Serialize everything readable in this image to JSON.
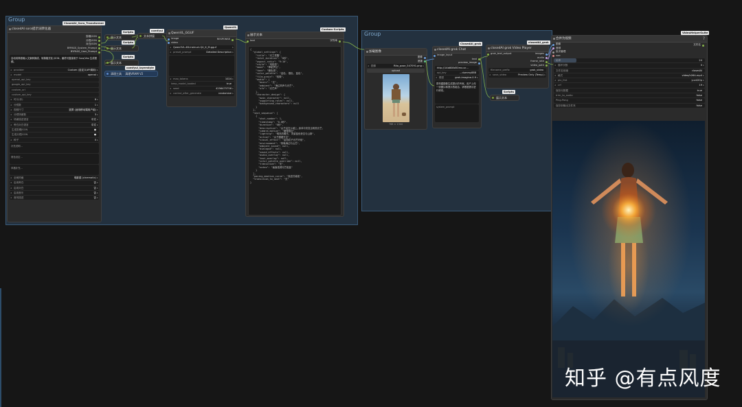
{
  "groups": {
    "left_title": "Group",
    "right_title": "Group"
  },
  "sora_node": {
    "tag": "ClosedAI_Sora_Transformer",
    "id": "#1149 ID",
    "title": "closedAI sora提示词转化器",
    "outputs": [
      "剪辑JSON",
      "分镜JSON",
      "对白JSON",
      "BYPASS_System_Prompt",
      "BYPASS_User_Prompt"
    ],
    "desc": "自动将简易输入文案转换成，转换格式化 JSON，最终可直接用于 Sora/Veo 生成视频。",
    "widgets": [
      {
        "k": "provider",
        "v": "Custom (自定义API调用)"
      },
      {
        "k": "model",
        "v": "openai"
      },
      {
        "k": "openai_api_key",
        "v": ""
      },
      {
        "k": "google_api_key",
        "v": ""
      },
      {
        "k": "custom_url",
        "v": ""
      },
      {
        "k": "custom_api_key",
        "v": ""
      },
      {
        "k": "时长(秒)",
        "v": "8"
      },
      {
        "k": "分镜数",
        "v": "1"
      },
      {
        "k": "视频尺寸",
        "v": "竖屏 (适用移动端用户组)"
      },
      {
        "k": "分镜场景数",
        "v": "3"
      },
      {
        "k": "场景描述语言",
        "v": "中文"
      },
      {
        "k": "旁白对白语言",
        "v": "中文"
      },
      {
        "k": "生成剪辑JSON",
        "v": ""
      },
      {
        "k": "生成分镜JSON",
        "v": ""
      },
      {
        "k": "种子",
        "v": "0"
      }
    ],
    "text_labels": [
      "补充说明...",
      "角色设定...",
      "风格补充..."
    ],
    "bottom_widgets": [
      {
        "k": "全局风格",
        "v": "电影感 (cinematic)"
      },
      {
        "k": "启用旁白",
        "v": "否"
      },
      {
        "k": "启用对白",
        "v": "否"
      },
      {
        "k": "启用音乐",
        "v": "否"
      },
      {
        "k": "音效描述",
        "v": "否"
      }
    ]
  },
  "scripts_nodes": {
    "tag1": "Scripts",
    "id1": "#1141 ID",
    "text1": "展示文本",
    "tag2": "Scripts",
    "id2": "#1146 ID",
    "text2": "展示文本",
    "tag3": "Scripts",
    "id3": "#1143 ID",
    "text3": "展示文本",
    "tag_text_concat": "comfyui",
    "text_concat": "文本拼接",
    "vram_tag": "comfyui_layerstyle",
    "vram_id": "#1144 ID",
    "vram_left": "清理工具",
    "vram_right": "清理VRAM V2"
  },
  "qwen_node": {
    "tag": "QwenVL",
    "id": "#1138 ID",
    "title": "QwenVL_GGUF",
    "inputs": [
      "image",
      "video"
    ],
    "output": "RESPONSE",
    "model": "Qwen3VL-4B-Instruct-Q4_K_M.gguf",
    "preset_prompt_k": "preset_prompt",
    "preset_prompt_v": "Detailed Description",
    "max_tokens_k": "max_tokens",
    "max_tokens_v": "1024",
    "keep_model_k": "keep_model_loaded",
    "keep_model_v": "true",
    "seed_k": "seed",
    "seed_v": "4256475756",
    "control_k": "control_after_generate",
    "control_v": "randomize"
  },
  "show_text_node": {
    "tag": "Custom-Scripts",
    "id": "#1139 ID",
    "title": "展示文本",
    "input": "text",
    "output": "字符串",
    "content": "{\n  \"global_settings\": {\n    \"title\": \"光之觉醒\",\n    \"total_duration\": \"8秒\",\n    \"aspect_ratio\": \"9:16\",\n    \"style\": \"电影感\",\n    \"mood\": \"神秘梦幻\",\n    \"tone\": \"暖色调\",\n    \"color_palette\": \"金色, 橙色, 蓝色\",\n    \"film_grain\": \"轻微\",\n    \"audio\": {\n      \"music\": \"无\",\n      \"ambient\": \"海边风声与光芒\",\n      \"sfx\": \"光芒声\"\n    },\n    \"character_design\": {\n      \"main_character\": null,\n      \"supporting_roles\": null,\n      \"background_characters\": null\n    }\n  },\n  \"shot_sequence\": [\n    {\n      \"shot_number\": 1,\n      \"timestamp\": \"0-8秒\",\n      \"duration\": \"8秒\",\n      \"description\": \"女子站在沙滩上,身体中央发出明亮光芒,\n      \"camera_motion\": \"缓慢推近\",\n      \"lighting\": \"明亮的暖光, 背景蓝色夜空与山脉\",\n      \"action\": \"女子缓缓升空\",\n      \"visual_effect\": \"金色粒子光芒环绕\",\n      \"environment\": \"夜晚海边与山峦\",\n      \"ambient_sound\": null,\n      \"dialogue\": null,\n      \"sound_effects\": null,\n      \"audio_overlay\": null,\n      \"text_overlay\": null,\n      \"color_palette_override\": null,\n      \"transition\": \"无\",\n      \"notes\": \"画面强调光芒能量\"\n    }\n  ],\n  \"pacing_emotion_curve\": \"渐进式增强\",\n  \"transition_to_next\": \"无\"\n}"
  },
  "load_image_node": {
    "id": "#1 ID",
    "title": "加载图像",
    "outputs": [
      "图像",
      "遮罩"
    ],
    "image_k": "图像",
    "image_v": "Rita_pose_547091.png",
    "upload": "upload",
    "size_label": "768 × 1344"
  },
  "grok_chat_node": {
    "tag": "ClosedAI_grok",
    "id": "#1,186 ID",
    "title": "closedAI grok Chat",
    "inputs": [
      "image_input"
    ],
    "outputs": [
      "text",
      "preview_image"
    ],
    "url": "http://14b808d50mx-vc...",
    "api_key_k": "api_key",
    "api_key_v": "...dummy888",
    "model_k": "模型",
    "model_v": "grok-imagine-0.9",
    "prompt_text": "是构建图像生成提示的专家。用户上传一张图片和提示的组合，请根据提示进行修改。",
    "system_prompt_label": "system_prompt"
  },
  "video_player_node": {
    "tag": "closedAI_grok",
    "id": "#1,73 ID",
    "title": "closedAI grok Video Player",
    "inputs": [
      "grok_text_output"
    ],
    "outputs": [
      "images",
      "audio",
      "frame_rate",
      "video_path"
    ],
    "filename_k": "filename_prefix",
    "filename_v": "grok_video",
    "save_k": "save_video",
    "save_v": "Preview Only (Temp)"
  },
  "scripts_mini": {
    "tag": "Scripts",
    "id": "#1,71 ID",
    "label": "展示文本"
  },
  "vhs_node": {
    "tag": "VideoHelperSuite",
    "id": "#1,88 ID",
    "title": "合并为视频",
    "inputs": [
      "图像",
      "音频",
      "批次管理",
      "vae"
    ],
    "output": "文件名",
    "widgets": [
      {
        "k": "帧率",
        "v": "24"
      },
      {
        "k": "循环次数",
        "v": "0"
      },
      {
        "k": "文件名前缀",
        "v": "closedAI"
      },
      {
        "k": "格式",
        "v": "video/h264-mp4"
      },
      {
        "k": "pix_fmt",
        "v": "yuv420p"
      },
      {
        "k": "crf",
        "v": "19"
      },
      {
        "k": "保存元数据",
        "v": "true"
      },
      {
        "k": "trim_to_audio",
        "v": "false"
      },
      {
        "k": "Ping-Pong",
        "v": "false"
      },
      {
        "k": "保存到输出文件夹",
        "v": "false"
      }
    ]
  },
  "watermark": "知乎 @有点风度",
  "colors": {
    "accent": "#f2c04a",
    "group": "#3a5a78",
    "node_bg": "#2b2b2b"
  }
}
